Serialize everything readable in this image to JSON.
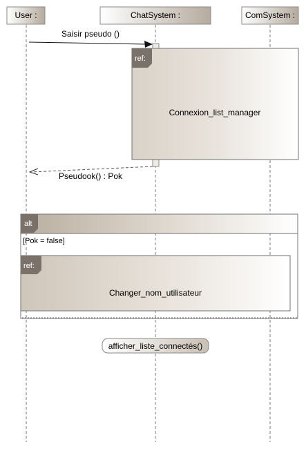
{
  "lifelines": [
    {
      "label": "User :"
    },
    {
      "label": "ChatSystem :"
    },
    {
      "label": "ComSystem :"
    }
  ],
  "messages": {
    "saisir": "Saisir pseudo ()",
    "pseudook": "Pseudook() : Pok"
  },
  "ref1": {
    "tag": "ref:",
    "label": "Connexion_list_manager"
  },
  "alt": {
    "tag": "alt",
    "guard": "[Pok = false]"
  },
  "ref2": {
    "tag": "ref:",
    "label": "Changer_nom_utilisateur"
  },
  "state": {
    "label": "afficher_liste_connectés()"
  },
  "colors": {
    "box_light": "#ffffff",
    "box_dark": "#b5ab9e",
    "tag_fill": "#7a726a",
    "line": "#6b6b6b"
  }
}
